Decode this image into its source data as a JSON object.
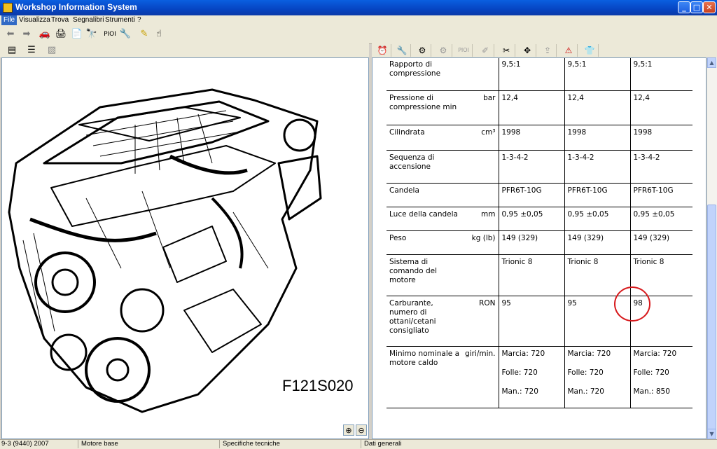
{
  "window": {
    "title": "Workshop Information System",
    "min": "_",
    "max": "□",
    "close": "✕"
  },
  "menu": [
    "File",
    "Visualizza",
    "Trova",
    "Segnalibri",
    "Strumenti",
    "?"
  ],
  "toolbar": {
    "pioi_label": "PIOI"
  },
  "right_toolbar": {
    "pioi_label": "PIOI"
  },
  "image": {
    "caption": "F121S020"
  },
  "table": {
    "rows": [
      {
        "param": "Rapporto di compressione",
        "unit": "",
        "vals": [
          "9,5:1",
          "9,5:1",
          "9,5:1"
        ]
      },
      {
        "param": "Pressione di compressione min",
        "unit": "bar",
        "vals": [
          "12,4",
          "12,4",
          "12,4"
        ]
      },
      {
        "param": "Cilindrata",
        "unit": "cm³",
        "vals": [
          "1998",
          "1998",
          "1998"
        ]
      },
      {
        "param": "Sequenza di accensione",
        "unit": "",
        "vals": [
          "1-3-4-2",
          "1-3-4-2",
          "1-3-4-2"
        ]
      },
      {
        "param": "Candela",
        "unit": "",
        "vals": [
          "PFR6T-10G",
          "PFR6T-10G",
          "PFR6T-10G"
        ]
      },
      {
        "param": "Luce della candela",
        "unit": "mm",
        "vals": [
          "0,95 ±0,05",
          "0,95 ±0,05",
          "0,95 ±0,05"
        ]
      },
      {
        "param": "Peso",
        "unit": "kg (lb)",
        "vals": [
          "149 (329)",
          "149 (329)",
          "149 (329)"
        ]
      },
      {
        "param": "Sistema di comando del motore",
        "unit": "",
        "vals": [
          "Trionic 8",
          "Trionic 8",
          "Trionic 8"
        ]
      },
      {
        "param": "Carburante, numero di ottani/cetani consigliato",
        "unit": "RON",
        "vals": [
          "95",
          "95",
          "98"
        ]
      },
      {
        "param": "Minimo nominale a motore caldo",
        "unit": "giri/min.",
        "vals": [
          [
            "Marcia: 720",
            "Folle: 720",
            "Man.: 720"
          ],
          [
            "Marcia: 720",
            "Folle: 720",
            "Man.: 720"
          ],
          [
            "Marcia: 720",
            "Folle: 720",
            "Man.: 850"
          ]
        ]
      }
    ]
  },
  "status": [
    "9-3 (9440) 2007",
    "Motore base",
    "Specifiche tecniche",
    "Dati generali"
  ],
  "colors": {
    "annotation": "#d7191c",
    "titlebar": "#0645c2"
  }
}
